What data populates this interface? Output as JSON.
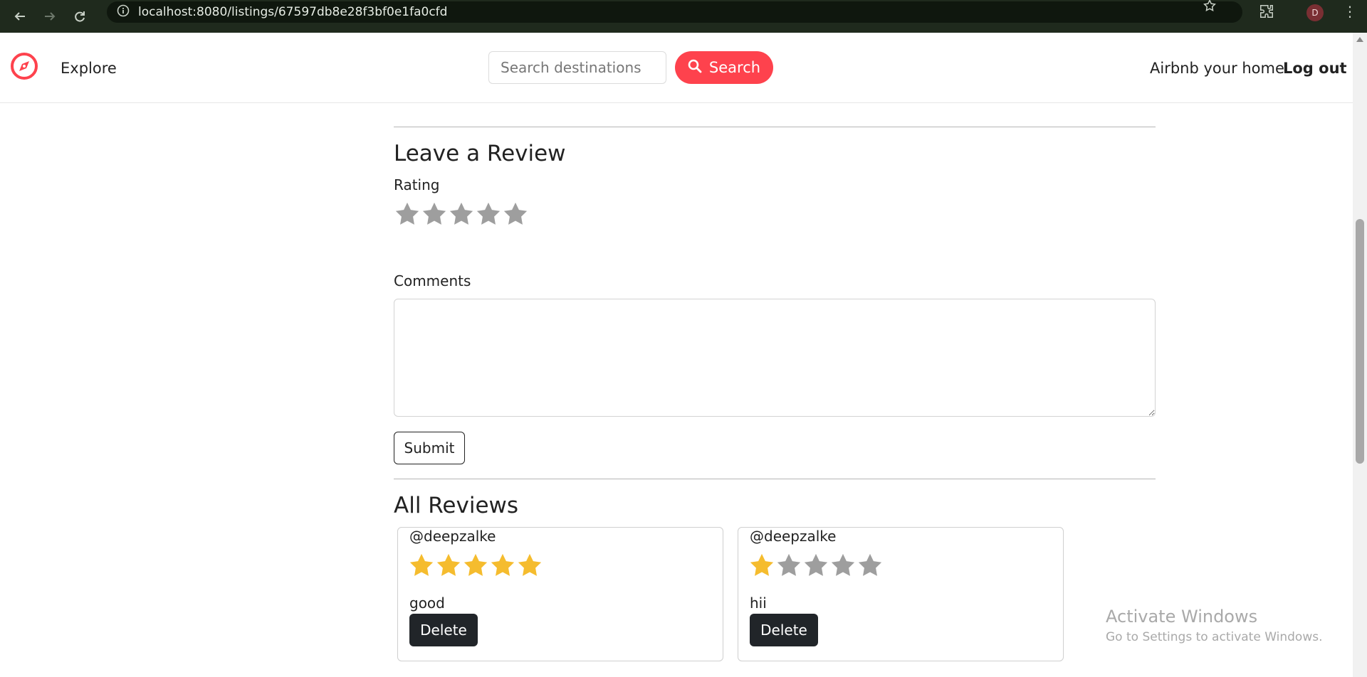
{
  "browser": {
    "url": "localhost:8080/listings/67597db8e28f3bf0e1fa0cfd",
    "avatar_initial": "D"
  },
  "navbar": {
    "explore": "Explore",
    "search_placeholder": "Search destinations",
    "search_button": "Search",
    "host_link": "Airbnb your home",
    "logout_link": "Log out",
    "brand_color": "#fe424d"
  },
  "review_form": {
    "heading": "Leave a Review",
    "rating_label": "Rating",
    "rating_value": 0,
    "rating_max": 5,
    "comments_label": "Comments",
    "comments_value": "",
    "submit_label": "Submit"
  },
  "reviews": {
    "heading": "All Reviews",
    "items": [
      {
        "author": "@deepzalke",
        "rating": 5,
        "comment": "good",
        "delete_label": "Delete"
      },
      {
        "author": "@deepzalke",
        "rating": 1,
        "comment": "hii",
        "delete_label": "Delete"
      }
    ]
  },
  "watermark": {
    "title": "Activate Windows",
    "subtitle": "Go to Settings to activate Windows."
  },
  "colors": {
    "star_filled": "#f5bc2e",
    "star_empty": "#9e9e9e",
    "chrome_bg": "#1f2a1d"
  }
}
